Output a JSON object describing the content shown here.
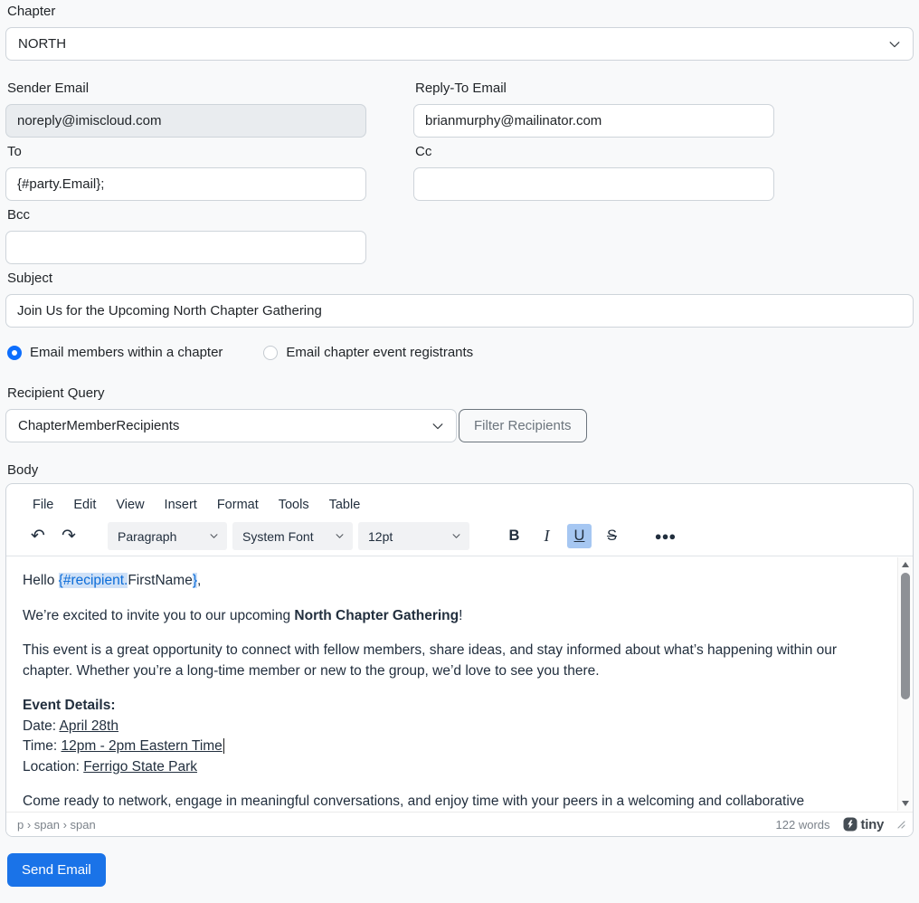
{
  "colors": {
    "accent": "#0d6efd",
    "send_button": "#1a73e8",
    "token_text": "#0b6cd8",
    "token_highlight": "#cfe1f7",
    "underline_active_bg": "#a6c7f2"
  },
  "form": {
    "chapter": {
      "label": "Chapter",
      "value": "NORTH"
    },
    "sender": {
      "label": "Sender Email",
      "value": "noreply@imiscloud.com"
    },
    "reply_to": {
      "label": "Reply-To Email",
      "value": "brianmurphy@mailinator.com"
    },
    "to": {
      "label": "To",
      "value": "{#party.Email};"
    },
    "cc": {
      "label": "Cc",
      "value": ""
    },
    "bcc": {
      "label": "Bcc",
      "value": ""
    },
    "subject": {
      "label": "Subject",
      "value": "Join Us for the Upcoming North Chapter Gathering"
    },
    "audience": {
      "options": [
        {
          "label": "Email members within a chapter",
          "selected": true
        },
        {
          "label": "Email chapter event registrants",
          "selected": false
        }
      ]
    },
    "recipient_query": {
      "label": "Recipient Query",
      "value": "ChapterMemberRecipients",
      "filter_button": "Filter Recipients"
    },
    "body_label": "Body",
    "send_button": "Send Email"
  },
  "editor": {
    "menu": [
      "File",
      "Edit",
      "View",
      "Insert",
      "Format",
      "Tools",
      "Table"
    ],
    "toolbar": {
      "paragraph": "Paragraph",
      "font": "System Font",
      "size": "12pt",
      "bold": "B",
      "italic": "I",
      "underline": "U",
      "strikethrough": "S"
    },
    "content": {
      "greeting_prefix": "Hello ",
      "token_open": "{#recipient.",
      "token_field": "FirstName",
      "token_close": "}",
      "greeting_suffix": ",",
      "para2_prefix": "We’re excited to invite you to our upcoming ",
      "para2_bold": "North Chapter Gathering",
      "para2_suffix": "!",
      "para3": "This event is a great opportunity to connect with fellow members, share ideas, and stay informed about what’s happening within our chapter. Whether you’re a long-time member or new to the group, we’d love to see you there.",
      "details_heading": "Event Details:",
      "date_label": "Date: ",
      "date_value": "April 28th",
      "time_label": "Time: ",
      "time_value": "12pm - 2pm Eastern Time",
      "location_label": "Location: ",
      "location_value": "Ferrigo State Park",
      "closing": "Come ready to network, engage in meaningful conversations, and enjoy time with your peers in a welcoming and collaborative"
    },
    "statusbar": {
      "path": "p › span › span",
      "wordcount": "122 words",
      "brand": "tiny"
    }
  }
}
